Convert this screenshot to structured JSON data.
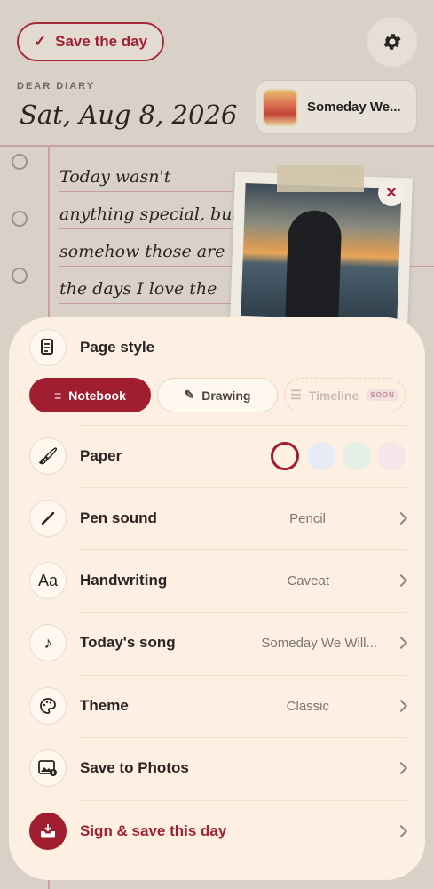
{
  "header": {
    "save_label": "Save the day",
    "dear_label": "DEAR DIARY",
    "date": "Sat, Aug 8, 2026",
    "song_card_title": "Someday We..."
  },
  "entry": {
    "lines": [
      "Today wasn't",
      "anything special, but",
      "somehow those are",
      "the days I love the"
    ],
    "close_glyph": "✕"
  },
  "sheet": {
    "page_style": {
      "label": "Page style",
      "options": [
        {
          "label": "Notebook",
          "active": true
        },
        {
          "label": "Drawing",
          "active": false
        },
        {
          "label": "Timeline",
          "badge": "SOON",
          "disabled": true
        }
      ]
    },
    "paper": {
      "label": "Paper",
      "swatches": [
        "#fdefe1",
        "#e7ebf5",
        "#e6efe6",
        "#f6e6e9"
      ]
    },
    "rows": [
      {
        "label": "Pen sound",
        "value": "Pencil",
        "icon": "pen-icon"
      },
      {
        "label": "Handwriting",
        "value": "Caveat",
        "icon": "text-aa-icon",
        "icon_text": "Aa"
      },
      {
        "label": "Today's song",
        "value": "Someday We Will...",
        "icon": "music-note-icon"
      },
      {
        "label": "Theme",
        "value": "Classic",
        "icon": "palette-icon"
      },
      {
        "label": "Save to Photos",
        "value": "",
        "icon": "photo-save-icon"
      },
      {
        "label": "Sign & save this day",
        "value": "",
        "icon": "inbox-save-icon"
      }
    ]
  },
  "colors": {
    "accent": "#a11e30",
    "sheet_bg": "#fdefe1",
    "page_bg": "#d9d1c7"
  }
}
